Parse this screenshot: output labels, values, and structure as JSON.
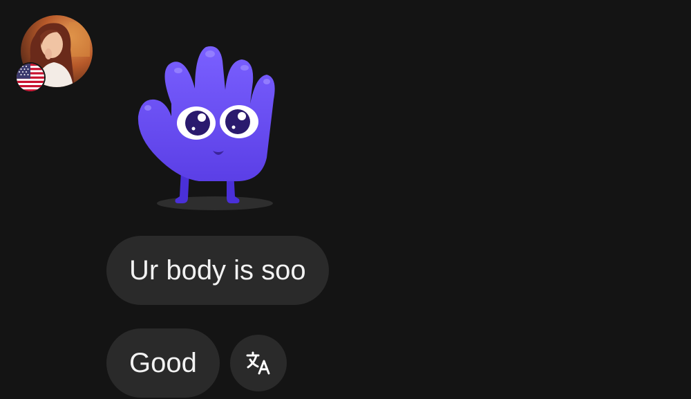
{
  "conversation": {
    "sender": {
      "avatar_icon": "profile-photo",
      "country_flag_icon": "us-flag-icon"
    },
    "messages": [
      {
        "type": "sticker",
        "icon": "waving-hand-mascot-sticker",
        "color": "#6a4ff0"
      },
      {
        "type": "text",
        "text": "Ur body is soo"
      },
      {
        "type": "text",
        "text": "Good"
      }
    ],
    "translate_icon": "translate-icon"
  },
  "colors": {
    "background": "#141414",
    "bubble": "#2a2a2a",
    "text": "#f2f2f2",
    "mascot": "#6a4ff0"
  }
}
